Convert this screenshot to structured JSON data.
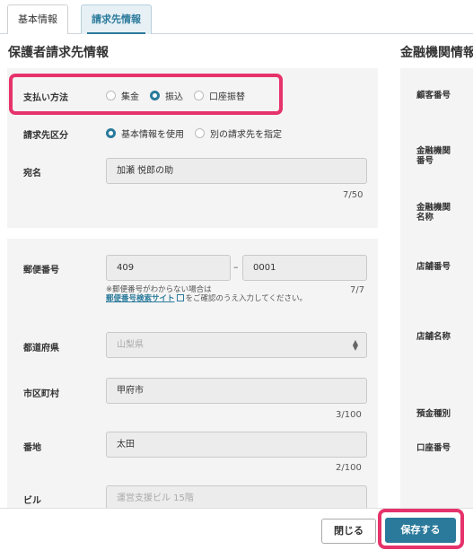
{
  "tabs": [
    {
      "label": "基本情報",
      "active": false
    },
    {
      "label": "請求先情報",
      "active": true
    }
  ],
  "left": {
    "title": "保護者請求先情報",
    "payment": {
      "label": "支払い方法",
      "options": [
        "集金",
        "振込",
        "口座振替"
      ],
      "selected": "振込"
    },
    "billing_type": {
      "label": "請求先区分",
      "options": [
        "基本情報を使用",
        "別の請求先を指定"
      ],
      "selected": "基本情報を使用"
    },
    "addressee": {
      "label": "宛名",
      "value": "加瀬 悦郎の助",
      "counter": "7/50"
    },
    "postal": {
      "label": "郵便番号",
      "part1": "409",
      "part2": "0001",
      "dash": "–",
      "counter": "7/7",
      "note_prefix": "※郵便番号がわからない場合は",
      "note_link": "郵便番号検索サイト",
      "note_suffix": "をご確認のうえ入力してください。"
    },
    "prefecture": {
      "label": "都道府県",
      "value": "山梨県"
    },
    "city": {
      "label": "市区町村",
      "value": "甲府市",
      "counter": "3/100"
    },
    "street": {
      "label": "番地",
      "value": "太田",
      "counter": "2/100"
    },
    "building": {
      "label": "ビル",
      "value": "運営支援ビル 15階"
    }
  },
  "right": {
    "title": "金融機関情報",
    "labels": {
      "customer_no": "顧客番号",
      "bank_no_1": "金融機関",
      "bank_no_2": "番号",
      "bank_name_1": "金融機関",
      "bank_name_2": "名称",
      "branch_no": "店舗番号",
      "branch_name": "店舗名称",
      "deposit_type": "預金種別",
      "account_no": "口座番号"
    }
  },
  "footer": {
    "close_label": "閉じる",
    "save_label": "保存する"
  },
  "colors": {
    "accent": "#2b7a9b",
    "highlight": "#e6336b"
  }
}
